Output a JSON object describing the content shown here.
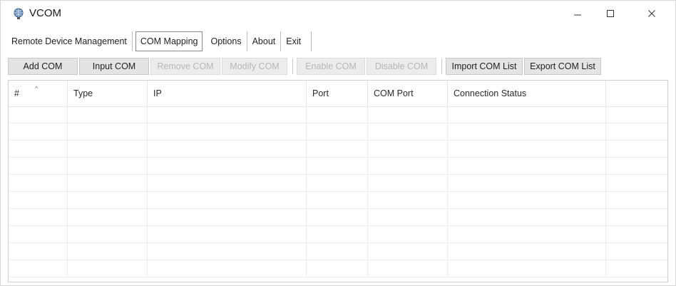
{
  "window": {
    "title": "VCOM",
    "icon": "globe-app-icon",
    "controls": [
      "minimize-icon",
      "maximize-icon",
      "close-icon"
    ]
  },
  "menu": {
    "items": [
      {
        "label": "Remote Device Management",
        "active": false
      },
      {
        "label": "COM Mapping",
        "active": true
      },
      {
        "label": "Options",
        "active": false
      },
      {
        "label": "About",
        "active": false
      },
      {
        "label": "Exit",
        "active": false
      }
    ]
  },
  "toolbar": {
    "add_com": "Add COM",
    "input_com": "Input COM",
    "remove_com": "Remove COM",
    "modify_com": "Modify COM",
    "enable_com": "Enable COM",
    "disable_com": "Disable COM",
    "import_com_list": "Import COM List",
    "export_com_list": "Export COM List"
  },
  "table": {
    "columns": [
      "#",
      "Type",
      "IP",
      "Port",
      "COM Port",
      "Connection Status"
    ],
    "sort_indicator": "^",
    "rows": []
  }
}
